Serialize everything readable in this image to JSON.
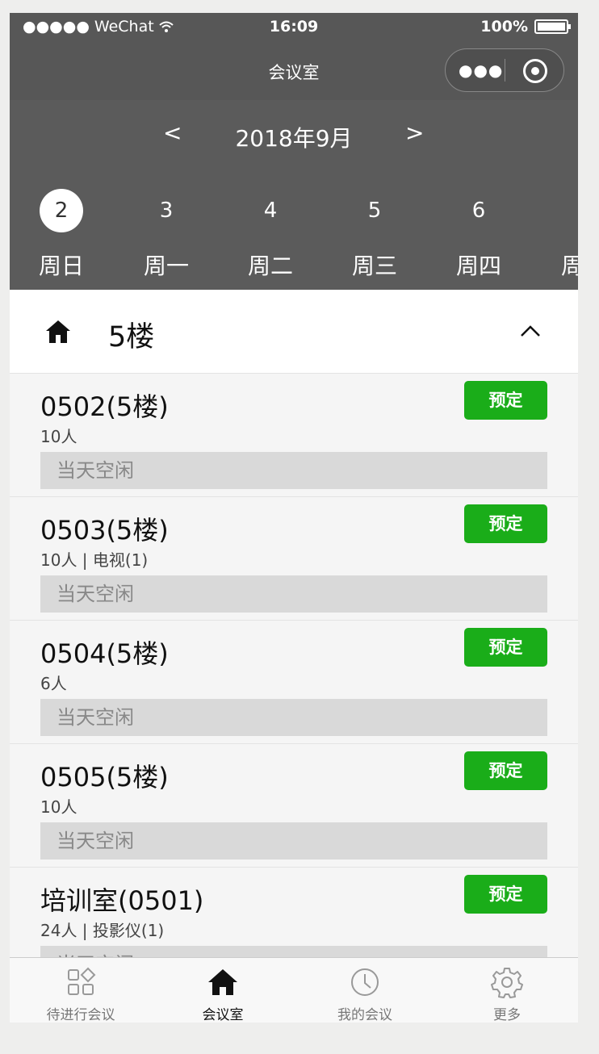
{
  "status": {
    "carrier": "●●●●● WeChat",
    "time": "16:09",
    "battery": "100%"
  },
  "nav": {
    "title": "会议室",
    "capsule_dots": "●●●"
  },
  "calendar": {
    "prev": "<",
    "next": ">",
    "month": "2018年9月",
    "days": [
      {
        "num": "2",
        "wk": "周日"
      },
      {
        "num": "3",
        "wk": "周一"
      },
      {
        "num": "4",
        "wk": "周二"
      },
      {
        "num": "5",
        "wk": "周三"
      },
      {
        "num": "6",
        "wk": "周四"
      },
      {
        "num": "",
        "wk": "周"
      }
    ]
  },
  "floor": {
    "name": "5楼"
  },
  "rooms": [
    {
      "name": "0502(5楼)",
      "info": "10人",
      "status": "当天空闲",
      "book": "预定"
    },
    {
      "name": "0503(5楼)",
      "info": "10人 | 电视(1)",
      "status": "当天空闲",
      "book": "预定"
    },
    {
      "name": "0504(5楼)",
      "info": "6人",
      "status": "当天空闲",
      "book": "预定"
    },
    {
      "name": "0505(5楼)",
      "info": "10人",
      "status": "当天空闲",
      "book": "预定"
    },
    {
      "name": "培训室(0501)",
      "info": "24人 | 投影仪(1)",
      "status": "当天空闲",
      "book": "预定"
    }
  ],
  "tabs": [
    {
      "label": "待进行会议",
      "icon": "grid-icon"
    },
    {
      "label": "会议室",
      "icon": "home-icon"
    },
    {
      "label": "我的会议",
      "icon": "clock-icon"
    },
    {
      "label": "更多",
      "icon": "gear-icon"
    }
  ],
  "colors": {
    "header": "#575757",
    "accent": "#1aad19"
  }
}
